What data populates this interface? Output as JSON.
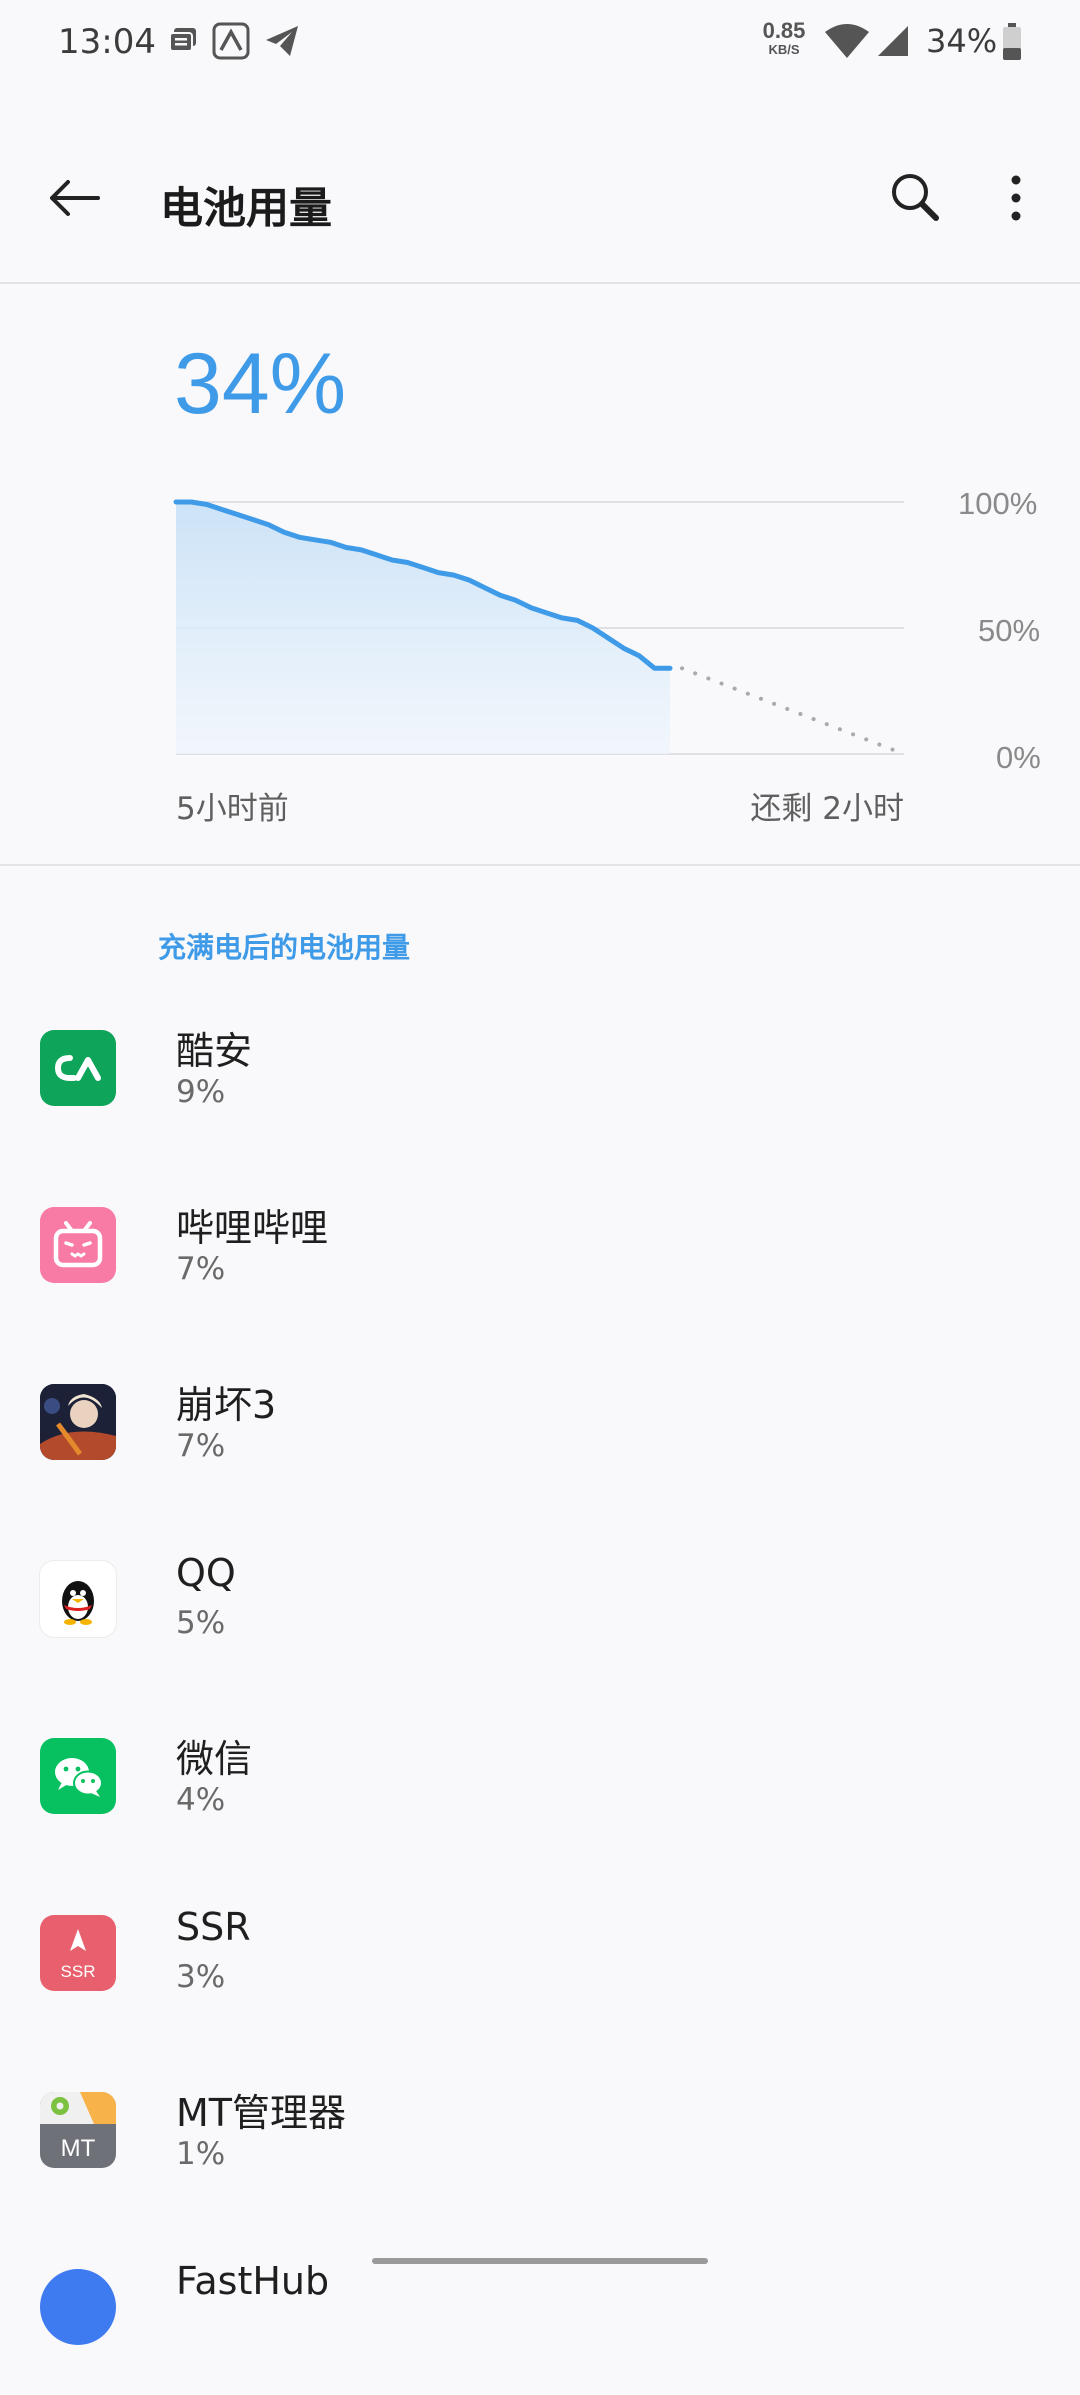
{
  "status_bar": {
    "time": "13:04",
    "net_speed": "0.85",
    "net_unit": "KB/S",
    "battery_text": "34%",
    "icons": [
      "notification-stack-icon",
      "coolapk-icon",
      "telegram-icon",
      "wifi-icon",
      "cellular-signal-icon",
      "battery-icon"
    ]
  },
  "header": {
    "title": "电池用量",
    "back_icon": "back-arrow-icon",
    "search_icon": "search-icon",
    "more_icon": "more-vert-icon"
  },
  "summary": {
    "battery_percent": "34%"
  },
  "chart_data": {
    "type": "area",
    "title": "",
    "xlabel": "",
    "ylabel": "",
    "x_start_label": "5小时前",
    "x_end_label": "还剩 2小时",
    "y_tick_labels": [
      "100%",
      "50%",
      "0%"
    ],
    "ylim": [
      0,
      100
    ],
    "grid": true,
    "series": [
      {
        "values": [
          100,
          100,
          99,
          97,
          95,
          93,
          91,
          88,
          86,
          85,
          84,
          82,
          81,
          79,
          77,
          76,
          74,
          72,
          71,
          69,
          66,
          63,
          61,
          58,
          56,
          54,
          53,
          50,
          46,
          42,
          39,
          34,
          34
        ],
        "color": "#3f9be8"
      },
      {
        "style": "dotted",
        "values_projection": [
          34,
          0
        ],
        "color": "#aaaaaa"
      }
    ]
  },
  "usage_section": {
    "header": "充满电后的电池用量",
    "apps": [
      {
        "name": "酷安",
        "percent": "9%",
        "icon": "coolapk-app-icon",
        "color": "#0ea45a"
      },
      {
        "name": "哔哩哔哩",
        "percent": "7%",
        "icon": "bilibili-app-icon",
        "color": "#f77ba5"
      },
      {
        "name": "崩坏3",
        "percent": "7%",
        "icon": "honkai3-app-icon",
        "color": "#2a2f4a"
      },
      {
        "name": "QQ",
        "percent": "5%",
        "icon": "qq-app-icon",
        "color": "#ffffff"
      },
      {
        "name": "微信",
        "percent": "4%",
        "icon": "wechat-app-icon",
        "color": "#07c160"
      },
      {
        "name": "SSR",
        "percent": "3%",
        "icon": "ssr-app-icon",
        "color": "#e8606d",
        "icon_label": "SSR"
      },
      {
        "name": "MT管理器",
        "percent": "1%",
        "icon": "mt-manager-app-icon",
        "color": "#6f7178",
        "icon_label": "MT"
      },
      {
        "name": "FastHub",
        "percent": "",
        "icon": "fasthub-app-icon",
        "color": "#3e7af0"
      }
    ]
  }
}
